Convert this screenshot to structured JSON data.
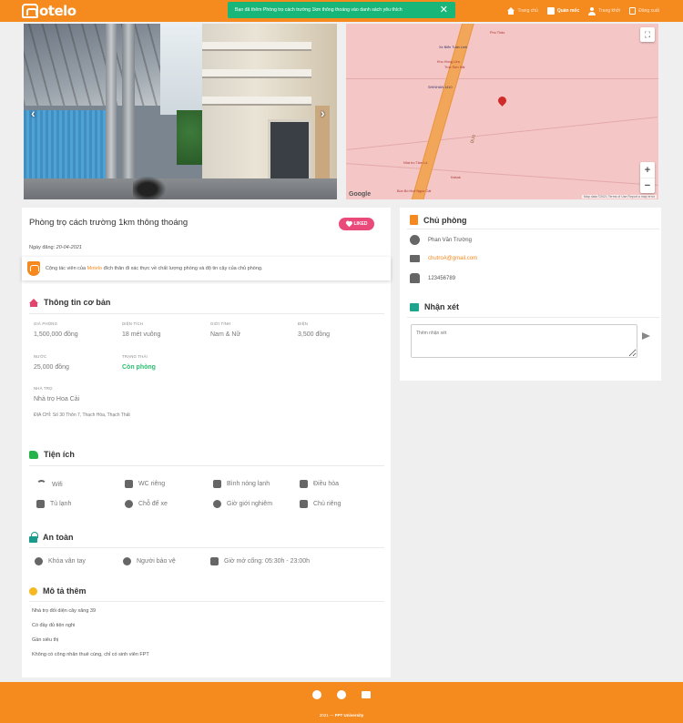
{
  "header": {
    "logo": "otelo",
    "nav": [
      {
        "label": "Trang chủ",
        "icon": "home-icon"
      },
      {
        "label": "Quản mốc",
        "icon": "box-icon"
      },
      {
        "label": "Trang khởi",
        "icon": "user-icon"
      },
      {
        "label": "Đăng xuất",
        "icon": "logout-icon"
      }
    ]
  },
  "toast": {
    "message": "Bạn đã thêm Phòng trọ cách trường 1km thông thoáng vào danh sách yêu thích",
    "close": "✕"
  },
  "map": {
    "labels": [
      "Xe Biển Tuấn Linh",
      "Phú Thảo",
      "Khu Hồng Lửa",
      "Trúc Sơn Hải",
      "SHINHAN 1410",
      "Nhà trọ Tâm Lộ",
      "Bún Bò Huế Ngọc Cát",
      "Kabuk"
    ],
    "road": "QL21",
    "google": "Google",
    "credit": "Map data ©2021   Terms of Use   Report a map error",
    "zoom_in": "+",
    "zoom_out": "−",
    "fullscreen": "⛶"
  },
  "gallery": {
    "prev": "‹",
    "next": "›"
  },
  "listing": {
    "title": "Phòng trọ cách trường 1km thông thoáng",
    "liked_label": "LIKED",
    "date_label": "Ngày đăng:",
    "date_value": "20-04-2021",
    "notice_prefix": "Cộng tác viên của",
    "notice_brand": "Motelo",
    "notice_suffix": "đích thân đi xác thực về chất lượng phòng và độ tin cậy của chủ phòng."
  },
  "basic": {
    "title": "Thông tin cơ bản",
    "price_label": "GIÁ PHÒNG",
    "price": "1,500,000 đồng",
    "area_label": "DIỆN TÍCH",
    "area": "18 mét vuông",
    "gender_label": "GIỚI TÍNH",
    "gender": "Nam & Nữ",
    "electric_label": "ĐIỆN",
    "electric": "3,500 đồng",
    "water_label": "NƯỚC",
    "water": "25,000 đồng",
    "status_label": "TRẠNG THÁI",
    "status": "Còn phòng",
    "motel_label": "NHÀ TRỌ",
    "motel": "Nhà trọ Hoa Cải",
    "address": "ĐỊA CHỈ: Số 30 Thôn 7, Thạch Hòa, Thạch Thất"
  },
  "amenities": {
    "title": "Tiện ích",
    "items": [
      "Wifi",
      "WC riêng",
      "Bình nóng lạnh",
      "Điều hòa",
      "Tủ lạnh",
      "Chỗ để xe",
      "Giờ giới nghiêm",
      "Chủ riêng"
    ]
  },
  "safety": {
    "title": "An toàn",
    "items": [
      "Khóa vân tay",
      "Người bảo vệ",
      "Giờ mở cổng: 05:30h - 23:00h"
    ]
  },
  "description": {
    "title": "Mô tả thêm",
    "lines": [
      "Nhà trọ đối diện cây xăng 39",
      "Có đầy đủ tiện nghi",
      "Gần siêu thị",
      "Không có công nhân thuê cùng, chỉ có sinh viên FPT"
    ]
  },
  "owner": {
    "title": "Chủ phòng",
    "name": "Phan Văn Trường",
    "email": "chutroA@gmail.com",
    "phone": "123456789"
  },
  "comments": {
    "title": "Nhận xét",
    "placeholder": "Thêm nhận xét"
  },
  "footer": {
    "copyright_prefix": "2021 — ",
    "copyright_org": "FPT University"
  },
  "colors": {
    "brand": "#f58a1f",
    "toast": "#19b67a",
    "liked": "#e94a7a",
    "available": "#2cc06e"
  }
}
